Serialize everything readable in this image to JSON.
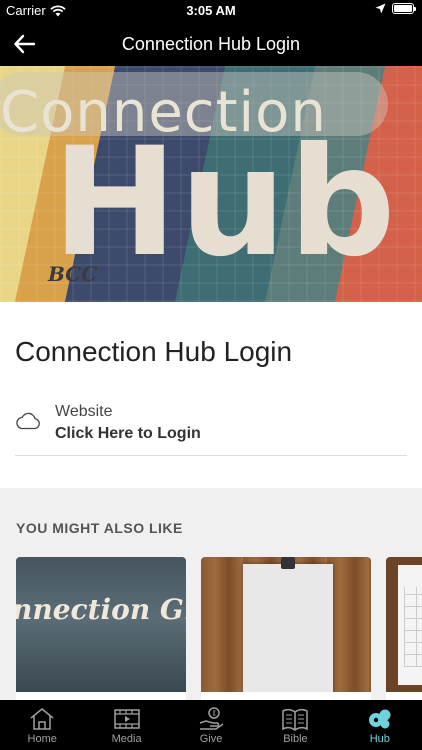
{
  "status_bar": {
    "carrier": "Carrier",
    "time": "3:05 AM",
    "battery_level": 1.0
  },
  "nav": {
    "title": "Connection Hub Login",
    "back_icon": "arrow-left-icon"
  },
  "hero": {
    "top_text": "Connection",
    "big_text": "Hub",
    "tag_text": "BCC"
  },
  "page": {
    "heading": "Connection Hub Login",
    "link": {
      "icon": "cloud-icon",
      "label": "Website",
      "value": "Click Here to Login"
    }
  },
  "related": {
    "heading": "YOU MIGHT ALSO LIKE",
    "items": [
      {
        "overlay_text": "nnection Gro"
      },
      {
        "overlay_text": ""
      },
      {
        "overlay_text": ""
      }
    ]
  },
  "tab_bar": {
    "active_color": "#6fd3dd",
    "inactive_color": "#a0a0a0",
    "tabs": [
      {
        "label": "Home",
        "icon": "home-icon",
        "active": false
      },
      {
        "label": "Media",
        "icon": "media-icon",
        "active": false
      },
      {
        "label": "Give",
        "icon": "give-icon",
        "active": false
      },
      {
        "label": "Bible",
        "icon": "bible-icon",
        "active": false
      },
      {
        "label": "Hub",
        "icon": "hub-icon",
        "active": true
      }
    ]
  }
}
